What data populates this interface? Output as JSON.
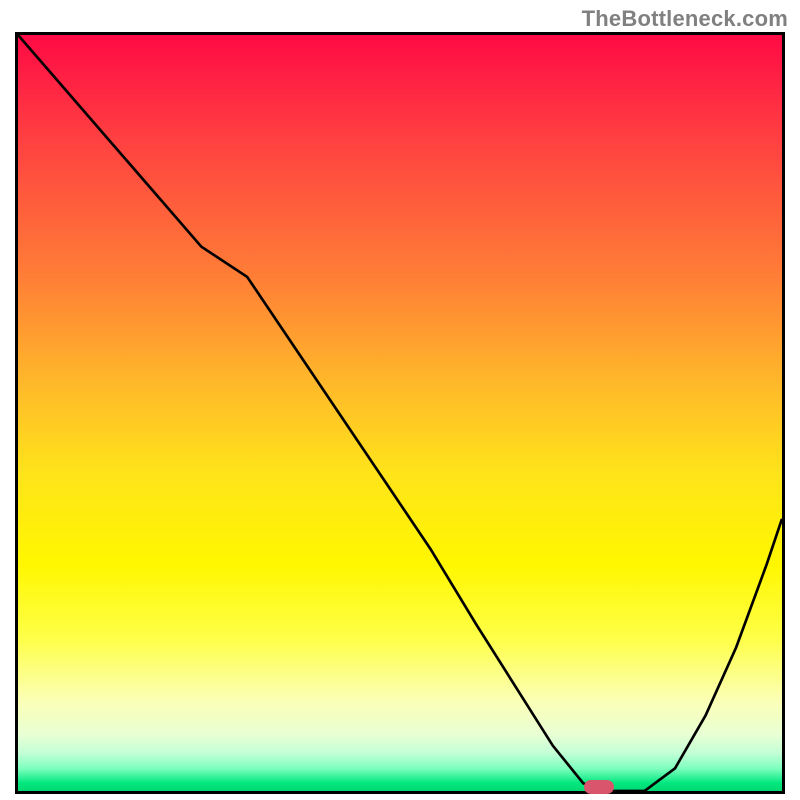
{
  "watermark": "TheBottleneck.com",
  "chart_data": {
    "type": "line",
    "title": "",
    "xlabel": "",
    "ylabel": "",
    "xlim": [
      0,
      100
    ],
    "ylim": [
      0,
      100
    ],
    "grid": false,
    "legend": false,
    "background_gradient": {
      "direction": "vertical",
      "stops": [
        {
          "pos": 0,
          "color": "#ff0a45"
        },
        {
          "pos": 14,
          "color": "#ff4141"
        },
        {
          "pos": 32,
          "color": "#ff7e36"
        },
        {
          "pos": 46,
          "color": "#ffb82a"
        },
        {
          "pos": 58,
          "color": "#ffe41a"
        },
        {
          "pos": 70,
          "color": "#fff700"
        },
        {
          "pos": 80,
          "color": "#feff4a"
        },
        {
          "pos": 88,
          "color": "#fbffb5"
        },
        {
          "pos": 92.5,
          "color": "#e9ffd4"
        },
        {
          "pos": 95,
          "color": "#c3ffd6"
        },
        {
          "pos": 97,
          "color": "#7fffbf"
        },
        {
          "pos": 99,
          "color": "#00e77d"
        },
        {
          "pos": 100,
          "color": "#00d873"
        }
      ]
    },
    "series": [
      {
        "name": "bottleneck-curve",
        "color": "#000000",
        "x": [
          0,
          6,
          12,
          18,
          24,
          30,
          36,
          42,
          48,
          54,
          60,
          65,
          70,
          74,
          78,
          82,
          86,
          90,
          94,
          98,
          100
        ],
        "y": [
          100,
          93,
          86,
          79,
          72,
          68,
          59,
          50,
          41,
          32,
          22,
          14,
          6,
          1,
          0,
          0,
          3,
          10,
          19,
          30,
          36
        ]
      }
    ],
    "marker": {
      "name": "optimal-point",
      "x": 76,
      "y": 0.5,
      "shape": "pill",
      "color": "#d9556c"
    }
  }
}
